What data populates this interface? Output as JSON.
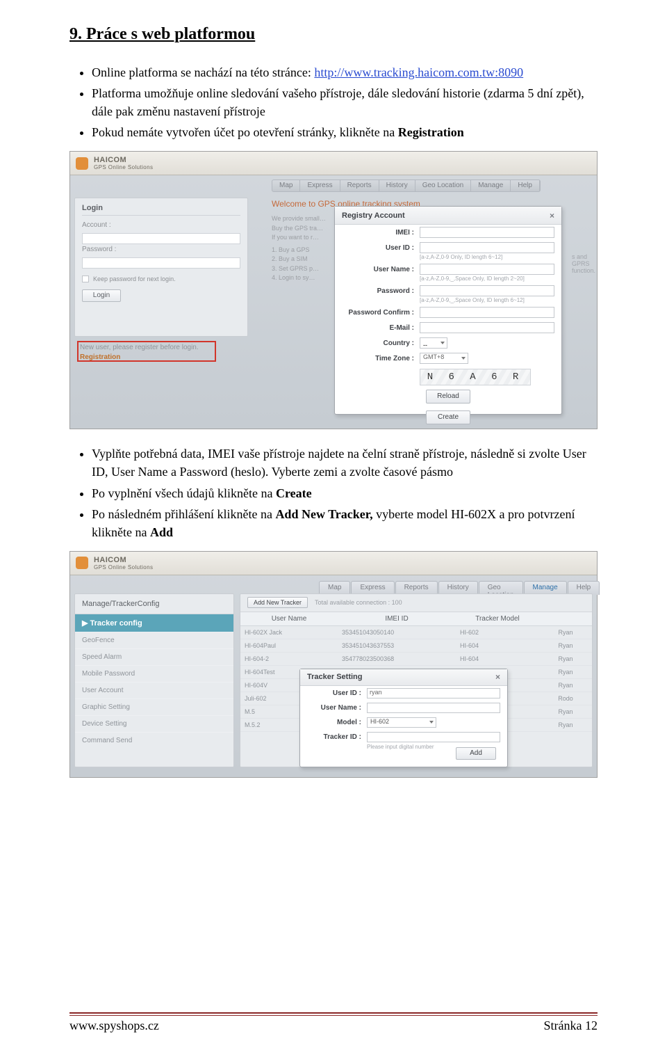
{
  "heading": "9. Práce s web platformou",
  "intro_list": {
    "item1a": "Online platforma se nachází na této stránce: ",
    "item1_link": "http://www.tracking.haicom.com.tw:8090",
    "item2": "Platforma umožňuje online sledování vašeho přístroje, dále sledování historie (zdarma 5 dní zpět), dále pak změnu nastavení přístroje",
    "item3a": "Pokud nemáte vytvořen účet po otevření stránky, klikněte na ",
    "item3_bold": "Registration"
  },
  "mid_list": {
    "item1a": "Vyplňte potřebná data, IMEI vaše přístroje najdete na čelní straně přístroje, následně si zvolte User ID, User Name a Password (heslo). Vyberte zemi a zvolte časové pásmo",
    "item2a": "Po vyplnění všech údajů klikněte na ",
    "item2_bold": "Create",
    "item3a": "Po následném přihlášení klikněte na ",
    "item3_bold1": "Add New Tracker,",
    "item3b": " vyberte model HI-602X a pro potvrzení klikněte na ",
    "item3_bold2": "Add"
  },
  "ss1": {
    "brand_top": "HAICOM",
    "brand_sub": "GPS Online Solutions",
    "nav": [
      "Map",
      "Express",
      "Reports",
      "History",
      "Geo Location",
      "Manage",
      "Help"
    ],
    "login": {
      "title": "Login",
      "account": "Account :",
      "password": "Password :",
      "remember": "Keep password for next login.",
      "login_btn": "Login"
    },
    "newuser_text": "New user, please register before login.",
    "registration": "Registration",
    "welcome": "Welcome to GPS online tracking system",
    "intro1": "We provide small…",
    "intro2": "Buy the GPS tra…",
    "intro3": "If you want to r…",
    "steps_prefix": [
      "1. Buy a GPS",
      "2. Buy a SIM",
      "3. Set GPRS p…",
      "4. Login to sy…"
    ],
    "side_info": "s and GPRS function.",
    "dialog": {
      "title": "Registry Account",
      "imei": "IMEI :",
      "userid": "User ID :",
      "userid_hint": "[a-z,A-Z,0-9 Only, ID length 6~12]",
      "username": "User Name :",
      "username_hint": "[a-z,A-Z,0-9,_,Space Only, ID length 2~20]",
      "password": "Password :",
      "password_hint": "[a-z,A-Z,0-9,_,Space Only, ID length 6~12]",
      "pwdconfirm": "Password Confirm :",
      "email": "E-Mail :",
      "country": "Country :",
      "country_sel": "--",
      "timezone": "Time Zone :",
      "tz_val": "GMT+8",
      "captcha": "N 6 A 6 R",
      "reload": "Reload",
      "create": "Create"
    }
  },
  "ss2": {
    "brand_top": "HAICOM",
    "brand_sub": "GPS Online Solutions",
    "tabs": [
      "Map",
      "Express",
      "Reports",
      "History",
      "Geo Location",
      "Manage",
      "Help"
    ],
    "breadcrumb": "Manage/TrackerConfig",
    "menu_active": "Tracker config",
    "menu": [
      "GeoFence",
      "Speed Alarm",
      "Mobile Password",
      "User Account",
      "Graphic Setting",
      "Device Setting",
      "Command Send"
    ],
    "panel": {
      "add_btn": "Add New Tracker",
      "note": "Total available connection : 100",
      "cols": [
        "User Name",
        "IMEI ID",
        "Tracker Model",
        ""
      ],
      "rows": [
        {
          "name": "HI-602X Jack",
          "imei": "353451043050140",
          "model": "HI-602",
          "act": "Ryan"
        },
        {
          "name": "HI-604Paul",
          "imei": "353451043637553",
          "model": "HI-604",
          "act": "Ryan"
        },
        {
          "name": "HI-604-2",
          "imei": "354778023500368",
          "model": "HI-604",
          "act": "Ryan"
        },
        {
          "name": "HI-604Test",
          "imei": "",
          "model": "",
          "act": "Ryan"
        },
        {
          "name": "HI-604V",
          "imei": "",
          "model": "",
          "act": "Ryan"
        },
        {
          "name": "Juli-602",
          "imei": "",
          "model": "",
          "act": "Rodo"
        },
        {
          "name": "M.5",
          "imei": "",
          "model": "",
          "act": "Ryan"
        },
        {
          "name": "M.5.2",
          "imei": "",
          "model": "",
          "act": "Ryan"
        }
      ]
    },
    "dialog": {
      "title": "Tracker Setting",
      "userid": "User ID :",
      "userid_val": "ryan",
      "username": "User Name :",
      "model": "Model :",
      "model_val": "HI-602",
      "trackerid": "Tracker ID :",
      "hint": "Please input digital number",
      "add": "Add"
    }
  },
  "footer": {
    "site": "www.spyshops.cz",
    "page": "Stránka 12"
  }
}
